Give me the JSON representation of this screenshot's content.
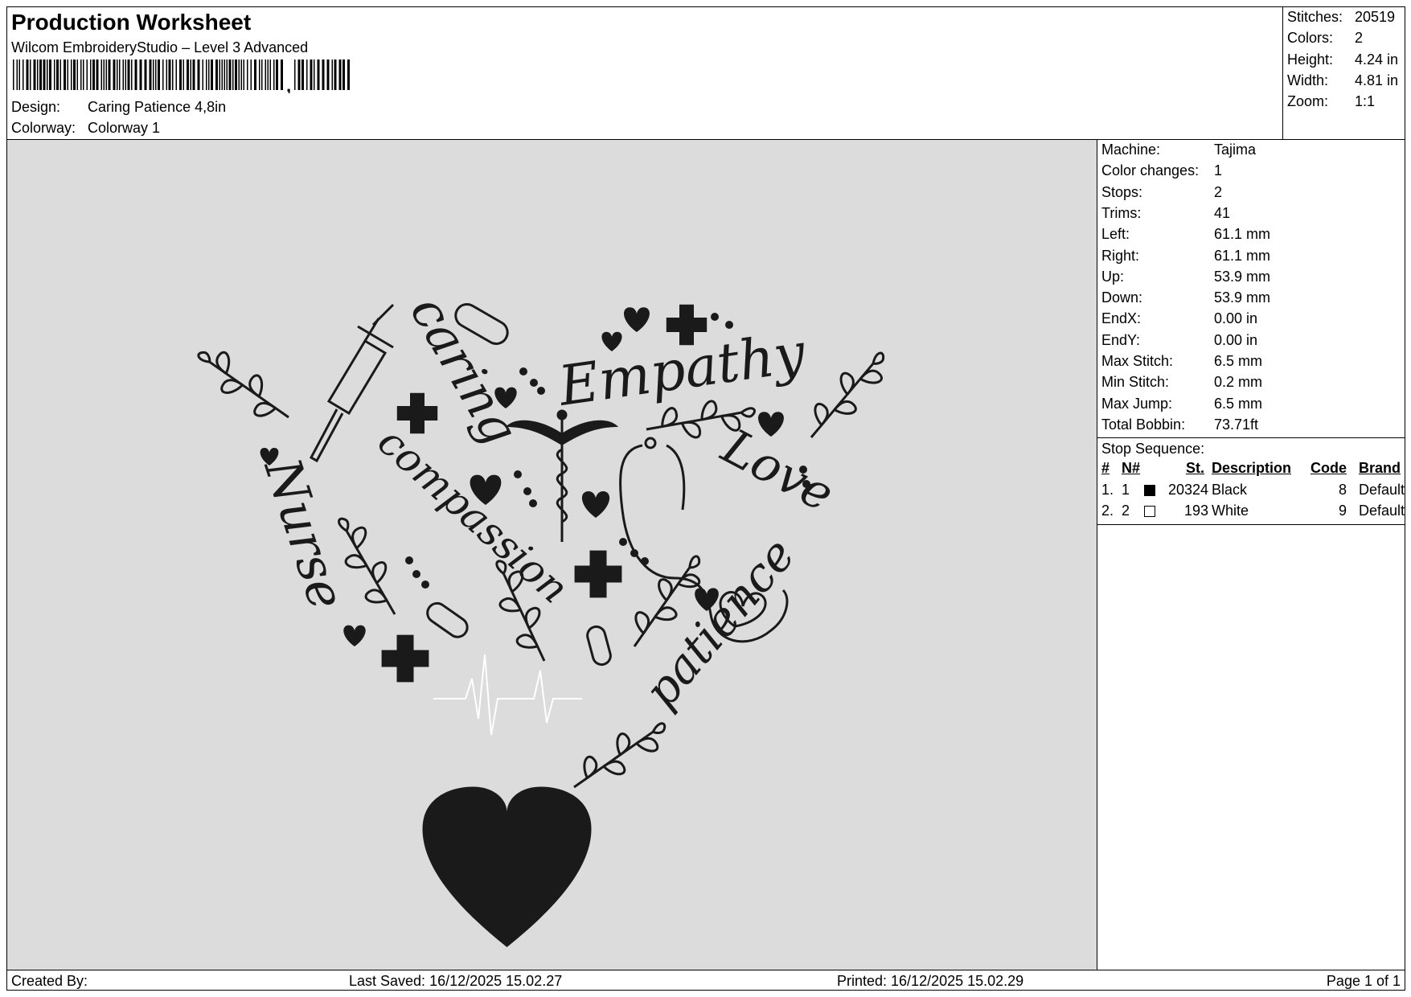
{
  "header": {
    "title": "Production Worksheet",
    "software": "Wilcom EmbroideryStudio – Level 3 Advanced",
    "design_label": "Design:",
    "design_value": "Caring Patience 4,8in",
    "colorway_label": "Colorway:",
    "colorway_value": "Colorway 1"
  },
  "top_stats": [
    {
      "label": "Stitches:",
      "value": "20519"
    },
    {
      "label": "Colors:",
      "value": "2"
    },
    {
      "label": "Height:",
      "value": "4.24 in"
    },
    {
      "label": "Width:",
      "value": "4.81 in"
    },
    {
      "label": "Zoom:",
      "value": "1:1"
    }
  ],
  "panel_stats": [
    {
      "label": "Machine:",
      "value": "Tajima"
    },
    {
      "label": "Color changes:",
      "value": "1"
    },
    {
      "label": "Stops:",
      "value": "2"
    },
    {
      "label": "Trims:",
      "value": "41"
    },
    {
      "label": "Left:",
      "value": "61.1 mm"
    },
    {
      "label": "Right:",
      "value": "61.1 mm"
    },
    {
      "label": "Up:",
      "value": "53.9 mm"
    },
    {
      "label": "Down:",
      "value": "53.9 mm"
    },
    {
      "label": "EndX:",
      "value": "0.00 in"
    },
    {
      "label": "EndY:",
      "value": "0.00 in"
    },
    {
      "label": "Max Stitch:",
      "value": "6.5 mm"
    },
    {
      "label": "Min Stitch:",
      "value": "0.2 mm"
    },
    {
      "label": "Max Jump:",
      "value": "6.5 mm"
    },
    {
      "label": "Total Bobbin:",
      "value": "73.71ft"
    }
  ],
  "stop_sequence": {
    "title": "Stop Sequence:",
    "headers": {
      "num": "#",
      "n": "N#",
      "st": "St.",
      "description": "Description",
      "code": "Code",
      "brand": "Brand"
    },
    "rows": [
      {
        "num": "1.",
        "n": "1",
        "color": "#000000",
        "st": "20324",
        "description": "Black",
        "code": "8",
        "brand": "Default"
      },
      {
        "num": "2.",
        "n": "2",
        "color": "#ffffff",
        "st": "193",
        "description": "White",
        "code": "9",
        "brand": "Default"
      }
    ]
  },
  "design_words": {
    "w1": "caring",
    "w2": "Empathy",
    "w3": "Love",
    "w4": "compassion",
    "w5": "Nurse",
    "w6": "patience"
  },
  "footer": {
    "created_by": "Created By:",
    "last_saved": "Last Saved: 16/12/2025 15.02.27",
    "printed": "Printed: 16/12/2025 15.02.29",
    "page": "Page 1 of 1"
  },
  "colors": {
    "preview_bg": "#dcdcdc",
    "thread_black": "#1a1a1a",
    "thread_white": "#ffffff"
  }
}
